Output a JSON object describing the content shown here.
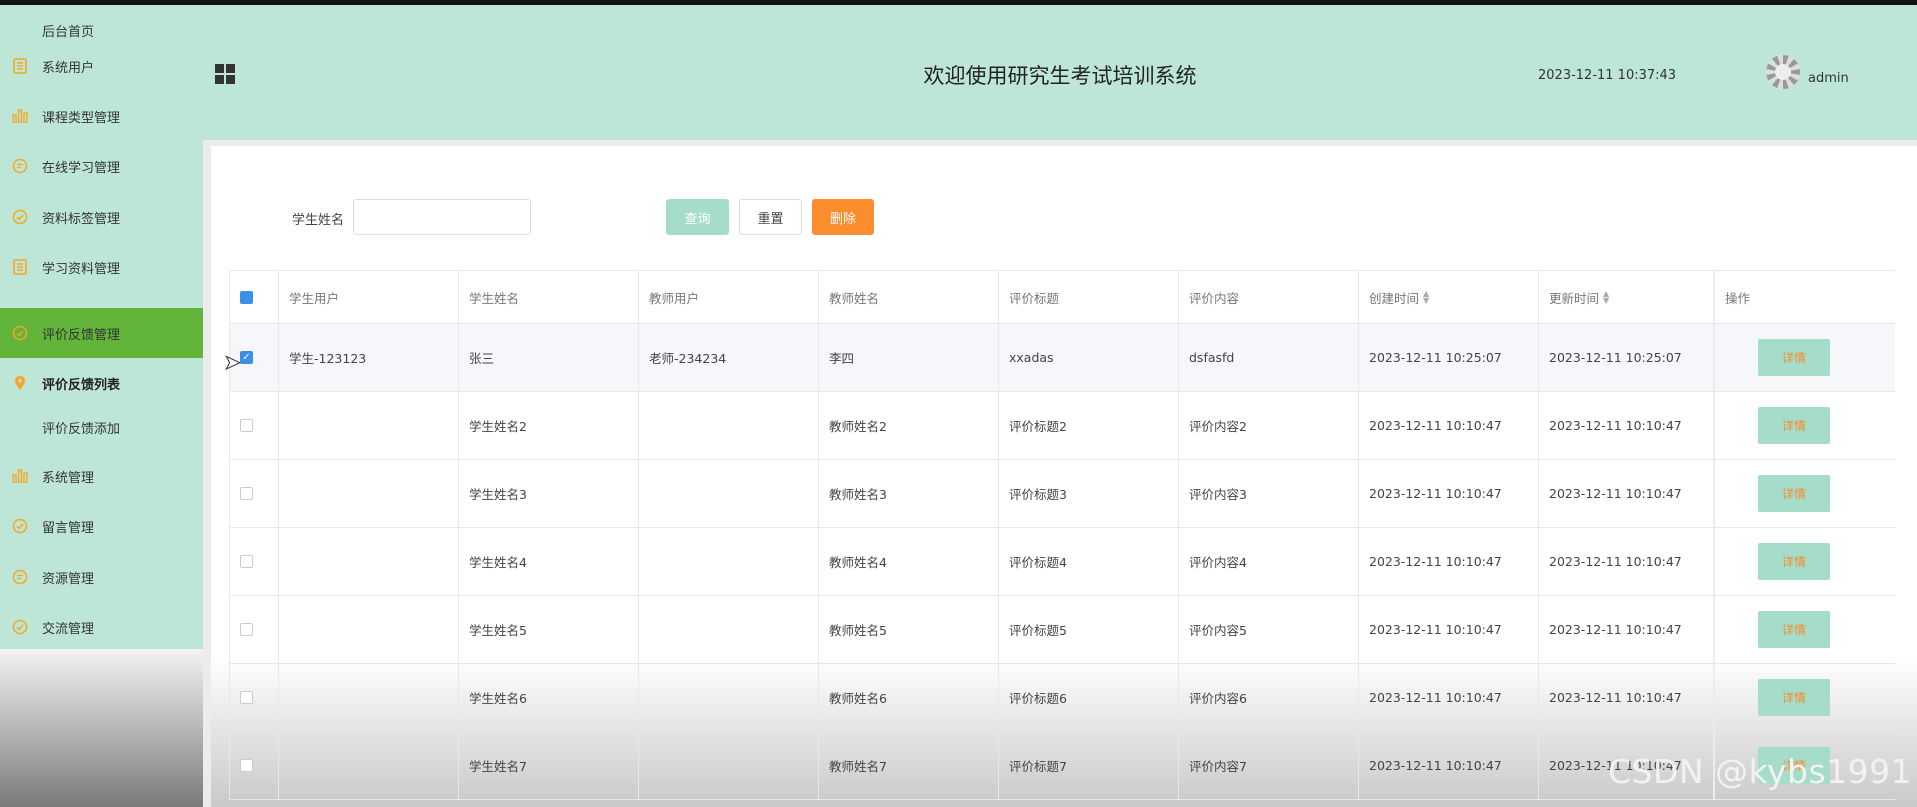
{
  "sidebar": {
    "items": [
      {
        "label": "后台首页",
        "icon": "none"
      },
      {
        "label": "系统用户",
        "icon": "document-icon"
      },
      {
        "label": "课程类型管理",
        "icon": "bar-chart-icon"
      },
      {
        "label": "在线学习管理",
        "icon": "chat-icon"
      },
      {
        "label": "资料标签管理",
        "icon": "check-circle-icon"
      },
      {
        "label": "学习资料管理",
        "icon": "document-icon"
      },
      {
        "label": "评价反馈管理",
        "icon": "check-circle-icon"
      },
      {
        "label": "评价反馈列表",
        "icon": "location-pin-icon"
      },
      {
        "label": "评价反馈添加",
        "icon": "none"
      },
      {
        "label": "系统管理",
        "icon": "bar-chart-icon"
      },
      {
        "label": "留言管理",
        "icon": "check-circle-icon"
      },
      {
        "label": "资源管理",
        "icon": "chat-icon"
      },
      {
        "label": "交流管理",
        "icon": "check-circle-icon"
      }
    ]
  },
  "header": {
    "title": "欢迎使用研究生考试培训系统",
    "datetime": "2023-12-11 10:37:43",
    "username": "admin"
  },
  "search": {
    "label": "学生姓名",
    "value": "",
    "query_label": "查询",
    "reset_label": "重置",
    "delete_label": "删除"
  },
  "table": {
    "columns": [
      "学生用户",
      "学生姓名",
      "教师用户",
      "教师姓名",
      "评价标题",
      "评价内容",
      "创建时间",
      "更新时间",
      "操作"
    ],
    "detail_label": "详情",
    "rows": [
      [
        "学生-123123",
        "张三",
        "老师-234234",
        "李四",
        "xxadas",
        "dsfasfd",
        "2023-12-11 10:25:07",
        "2023-12-11 10:25:07"
      ],
      [
        "",
        "学生姓名2",
        "",
        "教师姓名2",
        "评价标题2",
        "评价内容2",
        "2023-12-11 10:10:47",
        "2023-12-11 10:10:47"
      ],
      [
        "",
        "学生姓名3",
        "",
        "教师姓名3",
        "评价标题3",
        "评价内容3",
        "2023-12-11 10:10:47",
        "2023-12-11 10:10:47"
      ],
      [
        "",
        "学生姓名4",
        "",
        "教师姓名4",
        "评价标题4",
        "评价内容4",
        "2023-12-11 10:10:47",
        "2023-12-11 10:10:47"
      ],
      [
        "",
        "学生姓名5",
        "",
        "教师姓名5",
        "评价标题5",
        "评价内容5",
        "2023-12-11 10:10:47",
        "2023-12-11 10:10:47"
      ],
      [
        "",
        "学生姓名6",
        "",
        "教师姓名6",
        "评价标题6",
        "评价内容6",
        "2023-12-11 10:10:47",
        "2023-12-11 10:10:47"
      ],
      [
        "",
        "学生姓名7",
        "",
        "教师姓名7",
        "评价标题7",
        "评价内容7",
        "2023-12-11 10:10:47",
        "2023-12-11 10:10:47"
      ]
    ]
  },
  "watermark": "CSDN @kybs1991",
  "colors": {
    "sidebar_bg": "#bde6d6",
    "active": "#63b43b",
    "icon": "#f5a623",
    "delete": "#fb8d2e"
  }
}
